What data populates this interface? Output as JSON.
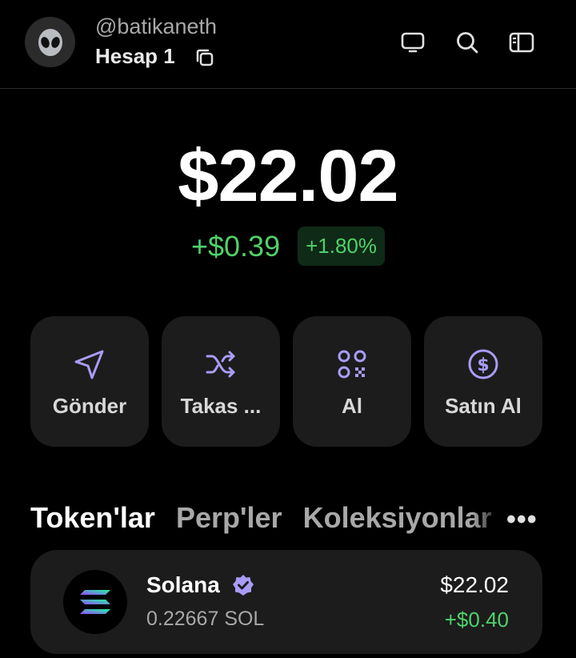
{
  "header": {
    "username": "@batikaneth",
    "account_name": "Hesap 1",
    "avatar_icon": "alien-icon",
    "icons": [
      "monitor-icon",
      "search-icon",
      "sidebar-icon"
    ]
  },
  "balance": {
    "total": "$22.02",
    "change_amount": "+$0.39",
    "change_percent": "+1.80%"
  },
  "actions": [
    {
      "label": "Gönder",
      "icon": "send-icon"
    },
    {
      "label": "Takas ...",
      "icon": "swap-icon"
    },
    {
      "label": "Al",
      "icon": "qr-icon"
    },
    {
      "label": "Satın Al",
      "icon": "dollar-icon"
    }
  ],
  "tabs": [
    "Token'lar",
    "Perp'ler",
    "Koleksiyonlar"
  ],
  "more_label": "•••",
  "tokens": [
    {
      "name": "Solana",
      "amount": "0.22667 SOL",
      "value": "$22.02",
      "change": "+$0.40",
      "icon": "solana-icon"
    }
  ],
  "colors": {
    "accent": "#a89cf7",
    "positive": "#4fd16a",
    "card": "#1c1c1c",
    "background": "#000000"
  }
}
